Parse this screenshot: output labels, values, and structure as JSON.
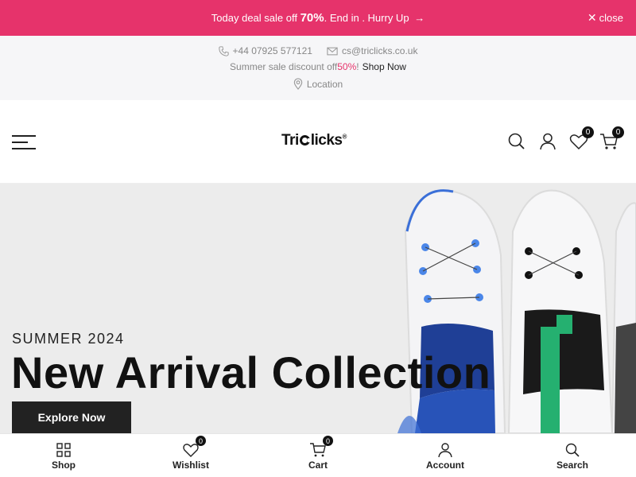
{
  "promo": {
    "prefix": "Today deal sale off ",
    "percent": "70%",
    "suffix": ". End in . Hurry Up",
    "arrow": "→",
    "close_label": "close",
    "background": "#e6336b"
  },
  "info": {
    "phone": "+44 07925 577121",
    "email": "cs@triclicks.co.uk",
    "discount_prefix": "Summer sale discount off ",
    "discount_percent": "50%",
    "discount_bang": "!",
    "shop_now": "Shop Now",
    "location": "Location",
    "icons": [
      "phone-icon",
      "mail-icon",
      "location-pin-icon"
    ]
  },
  "header": {
    "logo_part1": "Tri",
    "logo_part2": "licks",
    "logo_mark": "®",
    "wishlist_count": "0",
    "cart_count": "0",
    "icons": [
      "menu-icon",
      "search-icon",
      "account-icon",
      "heart-icon",
      "cart-icon"
    ]
  },
  "hero": {
    "eyebrow": "SUMMER 2024",
    "title": "New Arrival Collection",
    "button": "Explore Now"
  },
  "bottom_nav": {
    "items": [
      {
        "label": "Shop",
        "icon": "grid-icon"
      },
      {
        "label": "Wishlist",
        "icon": "heart-icon",
        "count": "0"
      },
      {
        "label": "Cart",
        "icon": "cart-icon",
        "count": "0"
      },
      {
        "label": "Account",
        "icon": "account-icon"
      },
      {
        "label": "Search",
        "icon": "search-icon"
      }
    ]
  }
}
